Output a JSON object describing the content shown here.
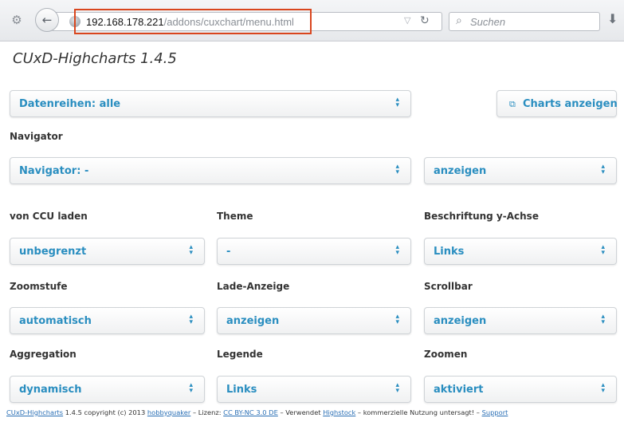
{
  "browser": {
    "url_host": "192.168.178.221",
    "url_path": "/addons/cuxchart/menu.html",
    "search_placeholder": "Suchen"
  },
  "page": {
    "title": "CUxD-Highcharts 1.4.5"
  },
  "controls": {
    "datenreihen": "Datenreihen: alle",
    "charts_button": "Charts anzeigen",
    "navigator_label": "Navigator",
    "navigator": "Navigator: -",
    "navigator_show": "anzeigen",
    "von_ccu_label": "von CCU laden",
    "von_ccu": "unbegrenzt",
    "theme_label": "Theme",
    "theme": "-",
    "beschriftung_label": "Beschriftung y-Achse",
    "beschriftung": "Links",
    "zoomstufe_label": "Zoomstufe",
    "zoomstufe": "automatisch",
    "lade_label": "Lade-Anzeige",
    "lade": "anzeigen",
    "scrollbar_label": "Scrollbar",
    "scrollbar": "anzeigen",
    "aggregation_label": "Aggregation",
    "aggregation": "dynamisch",
    "legende_label": "Legende",
    "legende": "Links",
    "zoomen_label": "Zoomen",
    "zoomen": "aktiviert"
  },
  "footer": {
    "app_link": "CUxD-Highcharts",
    "text1": " 1.4.5 copyright (c) 2013 ",
    "author_link": "hobbyquaker",
    "text2": " – Lizenz: ",
    "license_link": "CC BY-NC 3.0 DE",
    "text3": " – Verwendet ",
    "highstock_link": "Highstock",
    "text4": " – kommerzielle Nutzung untersagt! – ",
    "support_link": "Support"
  },
  "colors": {
    "accent": "#2a8ec0",
    "url_highlight": "#d9461e",
    "link": "#2a6fb5"
  },
  "icons": {
    "site_identity": "puzzle-icon",
    "back": "back-arrow-icon",
    "globe": "globe-icon",
    "url_dropdown": "chevron-down-icon",
    "reload": "reload-icon",
    "search": "search-icon",
    "download": "download-icon",
    "charts_button": "external-window-icon",
    "select_arrows": "updown-arrows-icon"
  }
}
